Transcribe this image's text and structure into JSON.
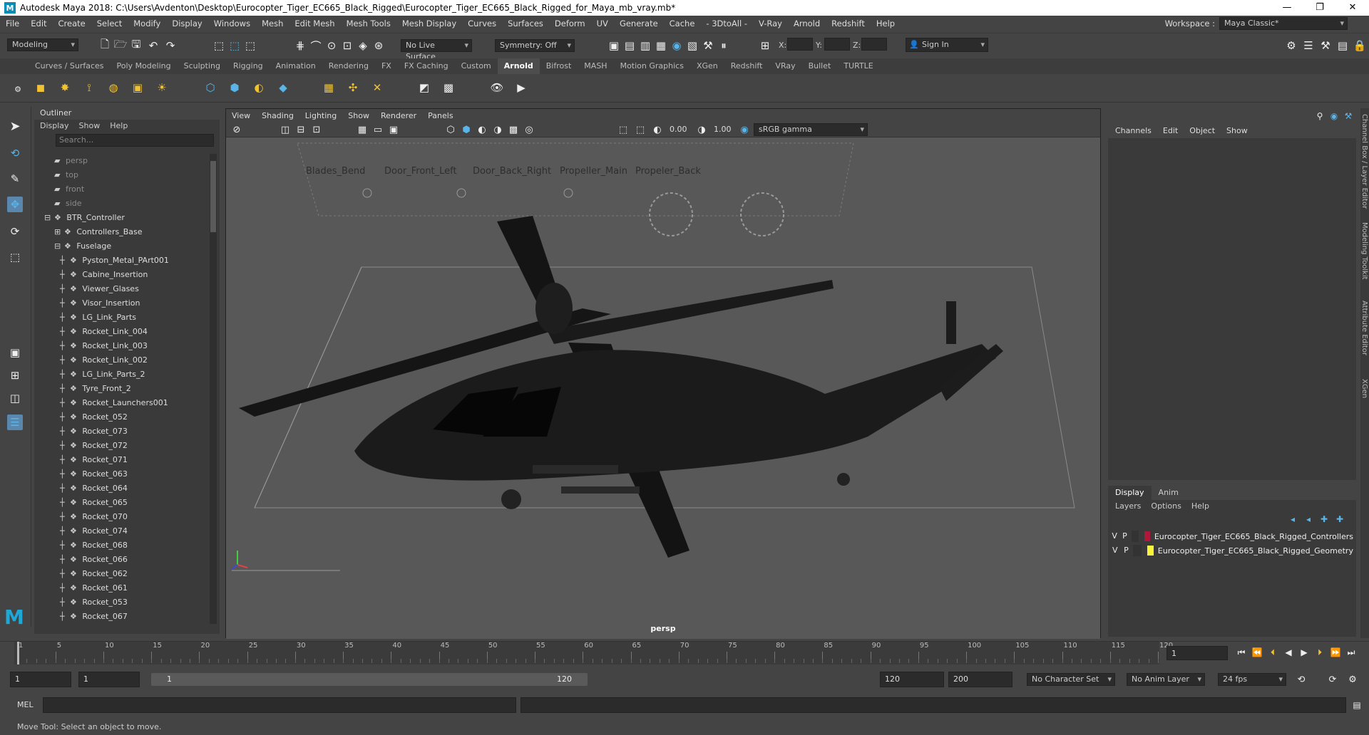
{
  "window": {
    "title": "Autodesk Maya 2018: C:\\Users\\Avdenton\\Desktop\\Eurocopter_Tiger_EC665_Black_Rigged\\Eurocopter_Tiger_EC665_Black_Rigged_for_Maya_mb_vray.mb*"
  },
  "menus": [
    "File",
    "Edit",
    "Create",
    "Select",
    "Modify",
    "Display",
    "Windows",
    "Mesh",
    "Edit Mesh",
    "Mesh Tools",
    "Mesh Display",
    "Curves",
    "Surfaces",
    "Deform",
    "UV",
    "Generate",
    "Cache",
    "- 3DtoAll -",
    "V-Ray",
    "Arnold",
    "Redshift",
    "Help"
  ],
  "workspace": {
    "label": "Workspace :",
    "value": "Maya Classic*"
  },
  "status": {
    "mode": "Modeling",
    "live_surface": "No Live Surface",
    "symmetry": "Symmetry: Off",
    "x_label": "X:",
    "y_label": "Y:",
    "z_label": "Z:",
    "sign_in": "Sign In"
  },
  "shelf_tabs": [
    "Curves / Surfaces",
    "Poly Modeling",
    "Sculpting",
    "Rigging",
    "Animation",
    "Rendering",
    "FX",
    "FX Caching",
    "Custom",
    "Arnold",
    "Bifrost",
    "MASH",
    "Motion Graphics",
    "XGen",
    "Redshift",
    "VRay",
    "Bullet",
    "TURTLE"
  ],
  "shelf_active": "Arnold",
  "outliner": {
    "title": "Outliner",
    "menu": [
      "Display",
      "Show",
      "Help"
    ],
    "search_placeholder": "Search...",
    "items": [
      {
        "label": "persp",
        "level": 0,
        "kind": "camera"
      },
      {
        "label": "top",
        "level": 0,
        "kind": "camera"
      },
      {
        "label": "front",
        "level": 0,
        "kind": "camera"
      },
      {
        "label": "side",
        "level": 0,
        "kind": "camera"
      },
      {
        "label": "BTR_Controller",
        "level": 0,
        "kind": "expanded"
      },
      {
        "label": "Controllers_Base",
        "level": 1,
        "kind": "collapsed"
      },
      {
        "label": "Fuselage",
        "level": 1,
        "kind": "expanded"
      },
      {
        "label": "Pyston_Metal_PArt001",
        "level": 2,
        "kind": "leaf"
      },
      {
        "label": "Cabine_Insertion",
        "level": 2,
        "kind": "leaf"
      },
      {
        "label": "Viewer_Glases",
        "level": 2,
        "kind": "leaf"
      },
      {
        "label": "Visor_Insertion",
        "level": 2,
        "kind": "leaf"
      },
      {
        "label": "LG_Link_Parts",
        "level": 2,
        "kind": "leaf"
      },
      {
        "label": "Rocket_Link_004",
        "level": 2,
        "kind": "leaf"
      },
      {
        "label": "Rocket_Link_003",
        "level": 2,
        "kind": "leaf"
      },
      {
        "label": "Rocket_Link_002",
        "level": 2,
        "kind": "leaf"
      },
      {
        "label": "LG_Link_Parts_2",
        "level": 2,
        "kind": "leaf"
      },
      {
        "label": "Tyre_Front_2",
        "level": 2,
        "kind": "leaf"
      },
      {
        "label": "Rocket_Launchers001",
        "level": 2,
        "kind": "leaf"
      },
      {
        "label": "Rocket_052",
        "level": 2,
        "kind": "leaf"
      },
      {
        "label": "Rocket_073",
        "level": 2,
        "kind": "leaf"
      },
      {
        "label": "Rocket_072",
        "level": 2,
        "kind": "leaf"
      },
      {
        "label": "Rocket_071",
        "level": 2,
        "kind": "leaf"
      },
      {
        "label": "Rocket_063",
        "level": 2,
        "kind": "leaf"
      },
      {
        "label": "Rocket_064",
        "level": 2,
        "kind": "leaf"
      },
      {
        "label": "Rocket_065",
        "level": 2,
        "kind": "leaf"
      },
      {
        "label": "Rocket_070",
        "level": 2,
        "kind": "leaf"
      },
      {
        "label": "Rocket_074",
        "level": 2,
        "kind": "leaf"
      },
      {
        "label": "Rocket_068",
        "level": 2,
        "kind": "leaf"
      },
      {
        "label": "Rocket_066",
        "level": 2,
        "kind": "leaf"
      },
      {
        "label": "Rocket_062",
        "level": 2,
        "kind": "leaf"
      },
      {
        "label": "Rocket_061",
        "level": 2,
        "kind": "leaf"
      },
      {
        "label": "Rocket_053",
        "level": 2,
        "kind": "leaf"
      },
      {
        "label": "Rocket_067",
        "level": 2,
        "kind": "leaf"
      }
    ]
  },
  "viewport": {
    "menu": [
      "View",
      "Shading",
      "Lighting",
      "Show",
      "Renderer",
      "Panels"
    ],
    "exposure": "0.00",
    "gamma": "1.00",
    "color_space": "sRGB gamma",
    "camera": "persp",
    "controls": [
      "Blades_Bend",
      "Door_Front_Left",
      "Door_Back_Right",
      "Propeller_Main",
      "Propeler_Back"
    ]
  },
  "channelbox": {
    "menu": [
      "Channels",
      "Edit",
      "Object",
      "Show"
    ]
  },
  "layers": {
    "tabs": [
      "Display",
      "Anim"
    ],
    "menu": [
      "Layers",
      "Options",
      "Help"
    ],
    "rows": [
      {
        "v": "V",
        "p": "P",
        "color": "#b0183a",
        "name": "Eurocopter_Tiger_EC665_Black_Rigged_Controllers"
      },
      {
        "v": "V",
        "p": "P",
        "color": "#f7f43a",
        "name": "Eurocopter_Tiger_EC665_Black_Rigged_Geometry"
      }
    ]
  },
  "side_tabs": [
    "Channel Box / Layer Editor",
    "Modeling Toolkit",
    "Attribute Editor",
    "XGen"
  ],
  "timeline": {
    "ticks": [
      "1",
      "5",
      "10",
      "15",
      "20",
      "25",
      "30",
      "35",
      "40",
      "45",
      "50",
      "55",
      "60",
      "65",
      "70",
      "75",
      "80",
      "85",
      "90",
      "95",
      "100",
      "105",
      "110",
      "115",
      "120"
    ],
    "current_frame": "1"
  },
  "range": {
    "start": "1",
    "anim_start": "1",
    "range_start": "1",
    "range_end": "120",
    "anim_end": "120",
    "end": "200",
    "character_set": "No Character Set",
    "anim_layer": "No Anim Layer",
    "fps": "24 fps"
  },
  "mel": {
    "label": "MEL"
  },
  "help_line": "Move Tool: Select an object to move."
}
